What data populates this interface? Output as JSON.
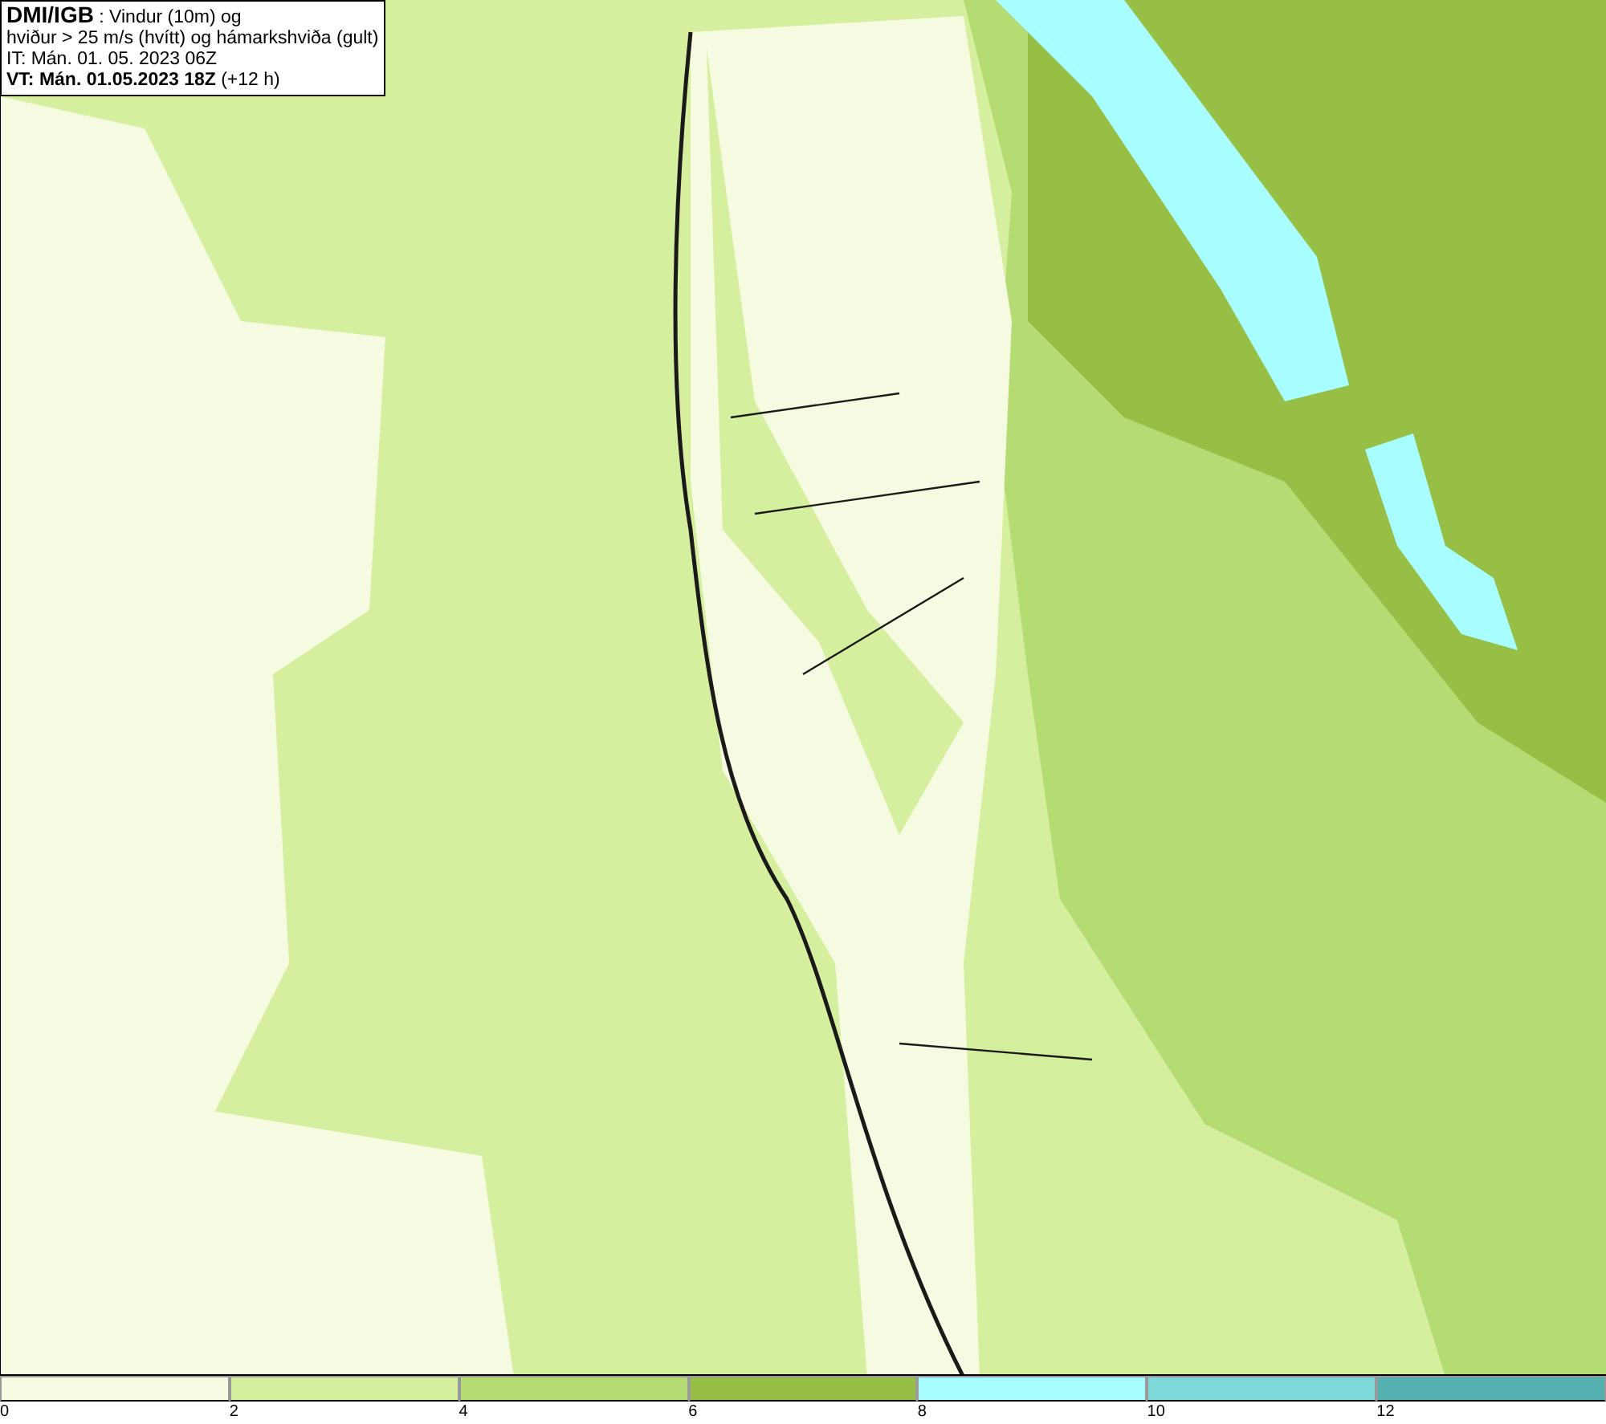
{
  "info_box": {
    "lines": [
      "**DMI/IGB** : Vindur (10m) og",
      "hviður > 25 m/s (hvítt) og hámarkshviða (gult)",
      "IT: Mán. 01. 05. 2023 06Z",
      "**VT: Mán. 01.05.2023 18Z** (+12 h)"
    ]
  },
  "legend": {
    "segments": [
      {
        "color": "#f4fbe0",
        "label": "0"
      },
      {
        "color": "#d5ef9f",
        "label": "2"
      },
      {
        "color": "#b5dc73",
        "label": "4"
      },
      {
        "color": "#98bf45",
        "label": "6"
      },
      {
        "color": "#a8fefe",
        "label": "8"
      },
      {
        "color": "#7fd8d8",
        "label": "10"
      },
      {
        "color": "#55b0b0",
        "label": "12"
      }
    ]
  }
}
